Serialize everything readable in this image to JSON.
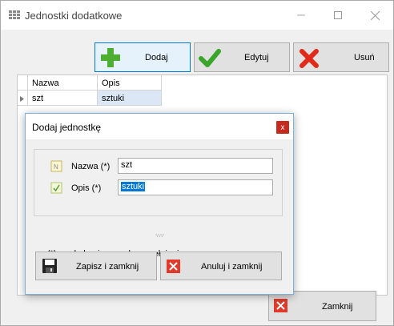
{
  "window": {
    "title": "Jednostki dodatkowe"
  },
  "toolbar": {
    "add_label": "Dodaj",
    "edit_label": "Edytuj",
    "delete_label": "Usuń"
  },
  "grid": {
    "columns": [
      "Nazwa",
      "Opis"
    ],
    "rows": [
      {
        "nazwa": "szt",
        "opis": "sztuki"
      }
    ]
  },
  "dialog": {
    "title": "Dodaj jednostkę",
    "close_glyph": "x",
    "name_label": "Nazwa (*)",
    "name_value": "szt",
    "desc_label": "Opis (*)",
    "desc_value": "sztuki",
    "required_note": "(*) - pola konieczne do wypełnienia",
    "save_label": "Zapisz i zamknij",
    "cancel_label": "Anuluj i zamknij"
  },
  "footer": {
    "close_label": "Zamknij"
  },
  "colors": {
    "accent": "#0078d7",
    "add_icon": "#4caf32",
    "check_icon": "#3aa52a",
    "delete_icon": "#e02a1a",
    "dialog_close": "#c42b1c"
  },
  "icons": [
    "app-icon",
    "plus-icon",
    "check-icon",
    "x-icon",
    "save-disk-icon",
    "cancel-x-icon"
  ]
}
